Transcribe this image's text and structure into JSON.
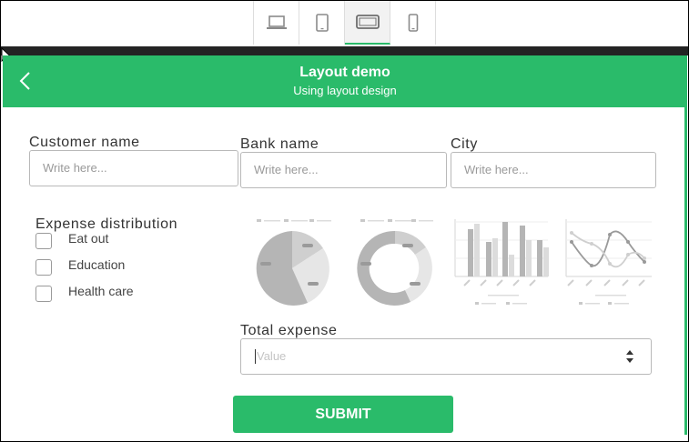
{
  "device_toolbar": {
    "items": [
      {
        "icon": "laptop-icon"
      },
      {
        "icon": "tablet-portrait-icon"
      },
      {
        "icon": "tablet-landscape-icon",
        "selected": true
      },
      {
        "icon": "phone-icon"
      }
    ]
  },
  "header": {
    "title": "Layout demo",
    "subtitle": "Using layout design",
    "back_icon": "chevron-left-icon"
  },
  "form": {
    "customer_name": {
      "label": "Customer name",
      "placeholder": "Write here..."
    },
    "bank_name": {
      "label": "Bank name",
      "placeholder": "Write here..."
    },
    "city": {
      "label": "City",
      "placeholder": "Write here..."
    },
    "expense_distribution": {
      "label": "Expense distribution",
      "options": [
        "Eat out",
        "Education",
        "Health care"
      ]
    },
    "total_expense": {
      "label": "Total expense",
      "placeholder": "Value"
    },
    "submit_label": "SUBMIT"
  },
  "colors": {
    "accent": "#2abb6a",
    "dark_strip": "#232323",
    "chart_gray": "#b5b5b5"
  }
}
